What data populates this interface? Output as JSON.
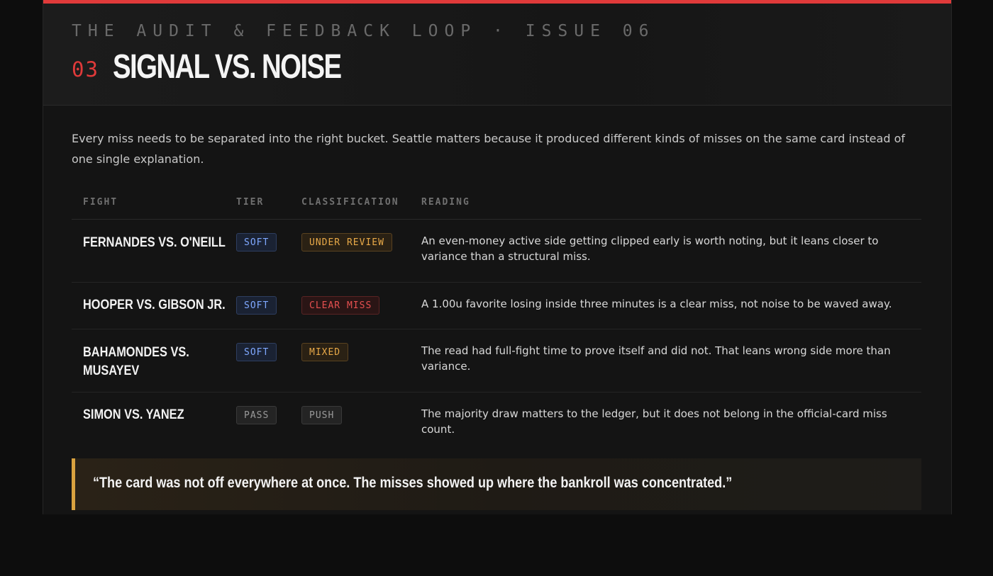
{
  "header": {
    "eyebrow": "THE AUDIT & FEEDBACK LOOP · ISSUE 06",
    "section_number": "03",
    "title": "SIGNAL VS. NOISE"
  },
  "intro": "Every miss needs to be separated into the right bucket. Seattle matters because it produced different kinds of misses on the same card instead of one single explanation.",
  "table": {
    "columns": [
      "FIGHT",
      "TIER",
      "CLASSIFICATION",
      "READING"
    ],
    "rows": [
      {
        "fight": "FERNANDES VS. O'NEILL",
        "tier": "SOFT",
        "classification": "UNDER REVIEW",
        "reading": "An even-money active side getting clipped early is worth noting, but it leans closer to variance than a structural miss."
      },
      {
        "fight": "HOOPER VS. GIBSON JR.",
        "tier": "SOFT",
        "classification": "CLEAR MISS",
        "reading": "A 1.00u favorite losing inside three minutes is a clear miss, not noise to be waved away."
      },
      {
        "fight": "BAHAMONDES VS. MUSAYEV",
        "tier": "SOFT",
        "classification": "MIXED",
        "reading": "The read had full-fight time to prove itself and did not. That leans wrong side more than variance."
      },
      {
        "fight": "SIMON VS. YANEZ",
        "tier": "PASS",
        "classification": "PUSH",
        "reading": "The majority draw matters to the ledger, but it does not belong in the official-card miss count."
      }
    ]
  },
  "quote": "“The card was not off everywhere at once. The misses showed up where the bankroll was concentrated.”",
  "colors": {
    "accent_red": "#e03a3a",
    "quote_gold": "#d9a23f",
    "soft_blue": "#7fa8ff",
    "review_amber": "#e8a948",
    "miss_red": "#e65050",
    "neutral_gray": "#9a9a9a"
  }
}
